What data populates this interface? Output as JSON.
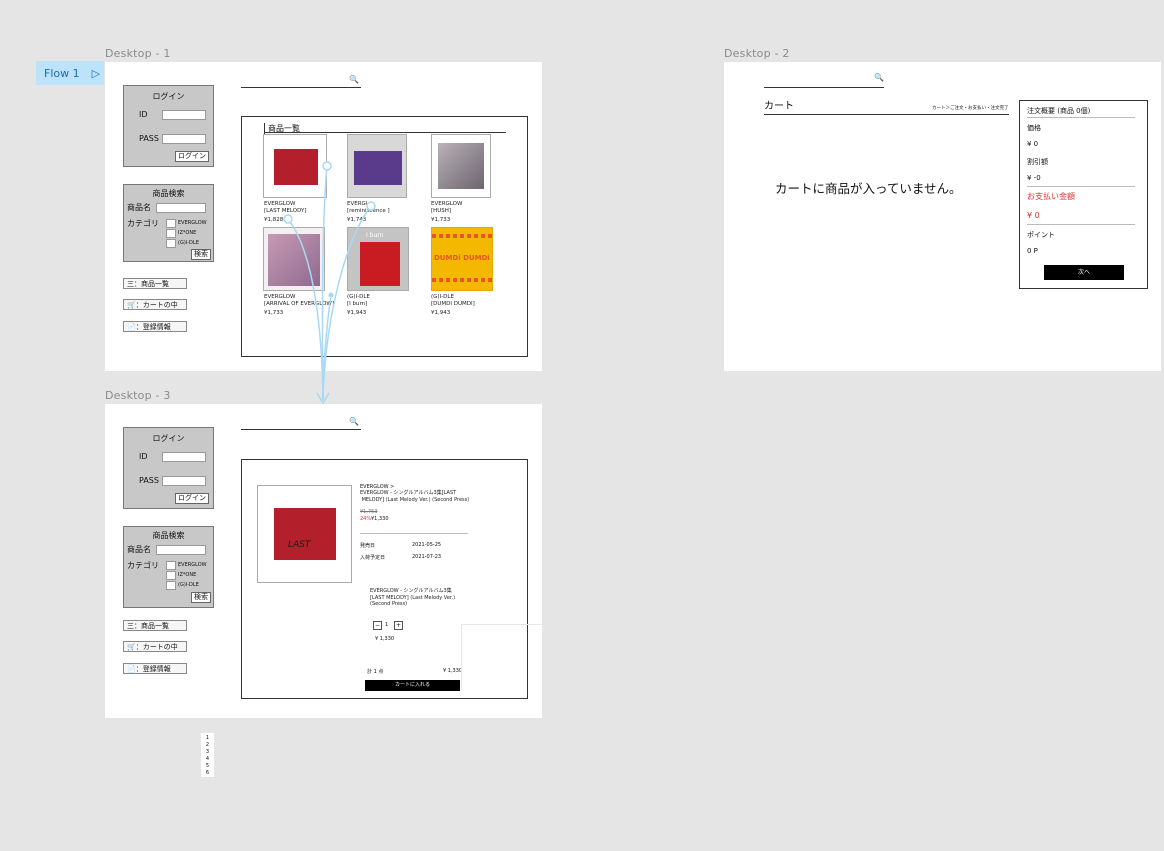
{
  "canvas_bg": "#e5e5e5",
  "flow": {
    "label": "Flow 1",
    "play_icon": "▷"
  },
  "frames": {
    "d1": {
      "label": "Desktop - 1"
    },
    "d2": {
      "label": "Desktop - 2"
    },
    "d3": {
      "label": "Desktop - 3"
    }
  },
  "search_icon": "🔍",
  "login": {
    "title": "ログイン",
    "id_label": "ID",
    "pass_label": "PASS",
    "button": "ログイン"
  },
  "product_search": {
    "title": "商品検索",
    "name_label": "商品名",
    "category_label": "カテゴリ",
    "categories": [
      "EVERGLOW",
      "IZ*ONE",
      "(G)I-DLE"
    ],
    "button": "検索"
  },
  "nav": {
    "product_list": "三：商品一覧",
    "cart": "🛒：カートの中",
    "registration": "📄：登録情報"
  },
  "catalog": {
    "title": "商品一覧",
    "items": [
      {
        "artist": "EVERGLOW",
        "title": "[LAST MELODY]",
        "price": "¥1,828"
      },
      {
        "artist": "EVERGL...",
        "title": "[reminiscence ]",
        "price": "¥1,743"
      },
      {
        "artist": "EVERGLOW",
        "title": "[HUSH]",
        "price": "¥1,733"
      },
      {
        "artist": "EVERGLOW",
        "title": "[ARRIVAL OF EVERGLOW]",
        "price": "¥1,733"
      },
      {
        "artist": "(G)I-DLE",
        "title": "[I burn]",
        "price": "¥1,943"
      },
      {
        "artist": "(G)I-DLE",
        "title": "[DUMDI DUMDI]",
        "price": "¥1,943"
      }
    ],
    "dumdi_art_text": "DUMDi DUMDi",
    "ibum_art_text": "I burn"
  },
  "cart": {
    "title": "カート",
    "steps": "カート＞ご注文・お支払い・注文完了",
    "empty_message": "カートに商品が入っていません。",
    "summary": {
      "header": "注文概要 (商品 0個)",
      "price_label": "価格",
      "price_value": "¥ 0",
      "discount_label": "割引額",
      "discount_value": "¥ -0",
      "total_label": "お支払い金額",
      "total_value": "¥ 0",
      "points_label": "ポイント",
      "points_value": "0 P",
      "next_button": "次へ"
    }
  },
  "detail": {
    "breadcrumb": "EVERGLOW >",
    "product_name": "EVERGLOW - シングルアルバム3集[LAST\n MELODY] (Last Melody Ver.) (Second Press)",
    "old_price": "¥1,753",
    "discount": "24%",
    "price": "¥1,330",
    "release_label": "発売日",
    "release_date": "2021-05-25",
    "arrival_label": "入荷予定日",
    "arrival_date": "2021-07-23",
    "option_name": "EVERGLOW - シングルアルバム3集\n[LAST MELODY] (Last Melody Ver.)\n(Second Press)",
    "qty_minus": "−",
    "qty_value": "1",
    "qty_plus": "+",
    "option_price": "¥ 1,330",
    "total_count": "計 1 点",
    "total_price": "¥ 1,330",
    "add_to_cart": "カートに入れる",
    "cover_text": "LAST"
  },
  "pagination": [
    "1",
    "2",
    "3",
    "4",
    "5",
    "6"
  ],
  "colors": {
    "flow_bg": "#bde3fb",
    "flow_text": "#1a6fa8",
    "connector": "#a8d8f5",
    "sale_red": "#e0322f",
    "gray_box": "#c8c8c8",
    "album_red": "#b3202b",
    "album_purple": "#5a3a8a",
    "album_yellow": "#f5b800"
  }
}
